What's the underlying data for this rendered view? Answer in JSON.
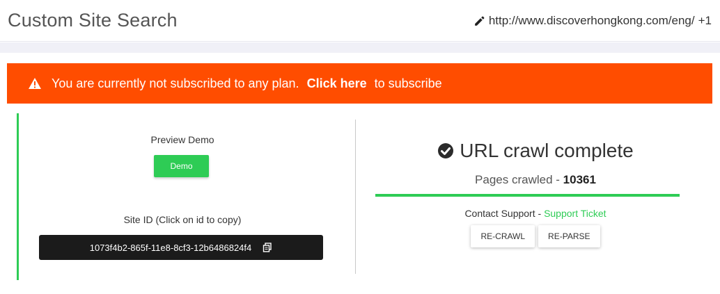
{
  "header": {
    "title": "Custom Site Search",
    "site_url": "http://www.discoverhongkong.com/eng/",
    "extra_sites": "+1"
  },
  "alert": {
    "text_before": "You are currently not subscribed to any plan.",
    "link": "Click here",
    "text_after": "to subscribe",
    "color": "#ff4d00"
  },
  "preview": {
    "label": "Preview Demo",
    "button": "Demo"
  },
  "site_id": {
    "label": "Site ID (Click on id to copy)",
    "value": "1073f4b2-865f-11e8-8cf3-12b6486824f4"
  },
  "crawl": {
    "status": "URL crawl complete",
    "pages_label": "Pages crawled -",
    "pages_count": "10361",
    "progress": 1.0,
    "support_label": "Contact Support -",
    "support_link": "Support Ticket",
    "recrawl_button": "RE-CRAWL",
    "reparse_button": "RE-PARSE"
  },
  "colors": {
    "accent": "#2ecc55",
    "warning": "#ff4d00"
  },
  "icons": {
    "edit": "pencil-icon",
    "warning": "warning-icon",
    "copy": "copy-icon",
    "complete": "check-circle-icon"
  }
}
